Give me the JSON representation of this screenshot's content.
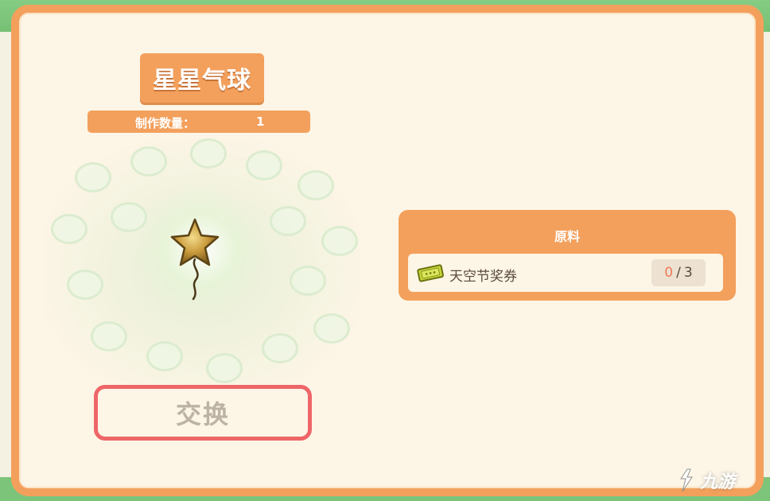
{
  "item": {
    "title": "星星气球",
    "quantity_label": "制作数量：",
    "quantity_value": "1",
    "icon": "star-balloon-icon"
  },
  "actions": {
    "exchange_label": "交换"
  },
  "materials": {
    "title": "原料",
    "items": [
      {
        "name": "天空节奖券",
        "have": "0",
        "separator": "/",
        "need": "3",
        "icon": "ticket-icon"
      }
    ]
  },
  "watermark": {
    "text": "九游",
    "icon": "jiuyou-logo-icon"
  },
  "colors": {
    "panel_border": "#f3a05c",
    "panel_bg": "#fdf5e6",
    "button_border": "#ee6668",
    "have_count": "#f07a5a",
    "background_green": "#7cc47a"
  }
}
